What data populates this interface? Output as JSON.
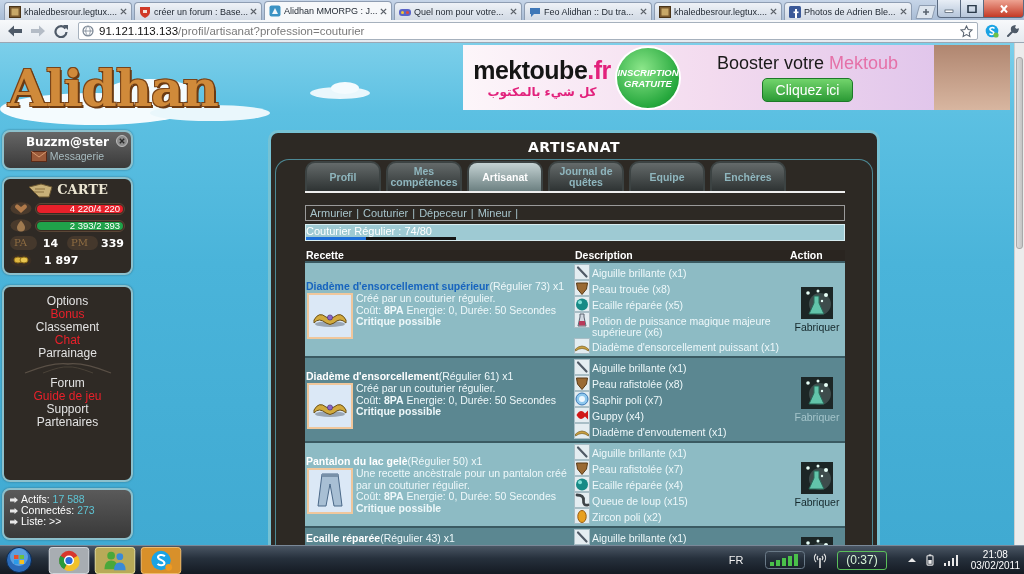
{
  "browser": {
    "tabs": [
      {
        "title": "khaledbesrour.legtux....",
        "kind": "photo",
        "selected": false
      },
      {
        "title": "créer un forum : Base...",
        "kind": "shield",
        "selected": false
      },
      {
        "title": "Alidhan MMORPG : J...",
        "kind": "game",
        "selected": true
      },
      {
        "title": "Quel nom pour votre...",
        "kind": "controller",
        "selected": false
      },
      {
        "title": "Feo Alidhan :: Du tra...",
        "kind": "forum",
        "selected": false
      },
      {
        "title": "khaledbesrour.legtux....",
        "kind": "photo",
        "selected": false
      },
      {
        "title": "Photos de Adrien Ble...",
        "kind": "social",
        "selected": false
      }
    ],
    "address": {
      "host": "91.121.113.133",
      "path": "/profil/artisanat?profession=couturier"
    }
  },
  "site": {
    "logo": "Alidhan",
    "banner": {
      "brand": "mektoube",
      "domain": ".fr",
      "tagline": "كل شيء بالمكتوب",
      "badge": "INSCRIPTION GRATUITE",
      "headline": "Booster votre",
      "headline_accent": "Mektoub",
      "button": "Cliquez ici"
    },
    "user": {
      "name": "Buzzm@ster",
      "messages": "Messagerie"
    },
    "card": {
      "title": "CARTE",
      "meters": [
        {
          "kind": "health",
          "reading": "4 220/4 220",
          "level": 1
        },
        {
          "kind": "mana",
          "reading": "2 393/2 393",
          "level": 1
        }
      ],
      "points": [
        {
          "label": "PA",
          "value": "14"
        },
        {
          "label": "PM",
          "value": "339"
        }
      ],
      "gold": "1 897"
    },
    "menu": [
      {
        "items": [
          {
            "label": "Options",
            "color": "#e2e2e2"
          },
          {
            "label": "Bonus",
            "color": "#e8202a"
          },
          {
            "label": "Classement",
            "color": "#e2e2e2"
          },
          {
            "label": "Chat",
            "color": "#e8202a"
          },
          {
            "label": "Parrainage",
            "color": "#e2e2e2"
          }
        ]
      },
      {
        "items": [
          {
            "label": "Forum",
            "color": "#e2e2e2"
          },
          {
            "label": "Guide de jeu",
            "color": "#e8202a"
          },
          {
            "label": "Support",
            "color": "#e2e2e2"
          },
          {
            "label": "Partenaires",
            "color": "#e2e2e2"
          }
        ]
      }
    ],
    "counters": [
      {
        "label": "Actifs:",
        "value": "17 588"
      },
      {
        "label": "Connectés:",
        "value": "273"
      },
      {
        "label": "Liste: >>"
      }
    ],
    "panel": {
      "title": "ARTISANAT",
      "tabs": [
        {
          "label": "Profil",
          "selected": false
        },
        {
          "label": "Mes compétences",
          "selected": false
        },
        {
          "label": "Artisanat",
          "selected": true
        },
        {
          "label": "Journal de quêtes",
          "selected": false
        },
        {
          "label": "Equipe",
          "selected": false
        },
        {
          "label": "Enchères",
          "selected": false
        }
      ],
      "professions": [
        "Armurier",
        "Couturier",
        "Dépeceur",
        "Mineur"
      ],
      "separator": "|",
      "progress": {
        "label": "Couturier Régulier : 74/80",
        "level": 0.4
      },
      "table": {
        "columns": [
          "Recette",
          "Description",
          "Action"
        ],
        "rows": [
          {
            "kind": "diadem",
            "name": "Diadème d'ensorcellement supérieur",
            "link": true,
            "grade": "(Régulier 73) x1",
            "description": "Créé par un couturier régulier.",
            "cost": "Coût: **8PA** Energie: 0, Durée: 50 Secondes",
            "note": "Critique possible",
            "ingredients": [
              {
                "kind": "needle",
                "text": "Aiguille brillante (x1)"
              },
              {
                "kind": "leather",
                "text": "Peau trouée (x8)"
              },
              {
                "kind": "orb",
                "text": "Ecaille réparée (x5)"
              },
              {
                "kind": "vial",
                "text": "Potion de puissance magique majeure supérieure (x6)"
              },
              {
                "kind": "diadem",
                "text": "Diadème d'ensorcellement puissant (x1)"
              }
            ],
            "action": {
              "label": "Fabriquer",
              "disabled": false
            }
          },
          {
            "kind": "diadem",
            "name": "Diadème d'ensorcellement",
            "link": false,
            "grade": "(Régulier 61) x1",
            "description": "Créé par un couturier régulier.",
            "cost": "Coût: **8PA** Energie: 0, Durée: 50 Secondes",
            "note": "Critique possible",
            "ingredients": [
              {
                "kind": "needle",
                "text": "Aiguille brillante (x1)"
              },
              {
                "kind": "leather",
                "text": "Peau rafistolée (x8)"
              },
              {
                "kind": "sapphire",
                "text": "Saphir poli (x7)"
              },
              {
                "kind": "fish",
                "text": "Guppy (x4)"
              },
              {
                "kind": "diadem",
                "text": "Diadème d'envoutement (x1)"
              }
            ],
            "action": {
              "label": "Fabriquer",
              "disabled": true
            }
          },
          {
            "kind": "pants",
            "name": "Pantalon du lac gelè",
            "link": false,
            "grade": "(Régulier 50) x1",
            "description": "Une recette ancèstrale pour un pantalon créé par un couturier régulier.",
            "cost": "Coût: **8PA** Energie: 0, Durée: 50 Secondes",
            "note": "Critique possible",
            "ingredients": [
              {
                "kind": "needle",
                "text": "Aiguille brillante (x1)"
              },
              {
                "kind": "leather",
                "text": "Peau rafistolée (x7)"
              },
              {
                "kind": "orb",
                "text": "Ecaille réparée (x4)"
              },
              {
                "kind": "tail",
                "text": "Queue de loup (x15)"
              },
              {
                "kind": "egg",
                "text": "Zircon poli (x2)"
              }
            ],
            "action": {
              "label": "Fabriquer",
              "disabled": false
            }
          },
          {
            "name": "Ecaille réparée",
            "link": false,
            "grade": "(Régulier 43) x1",
            "ingredients": [
              {
                "kind": "needle",
                "text": "Aiguille brillante (x1)"
              }
            ],
            "action": {
              "disabled": false
            }
          }
        ]
      }
    }
  },
  "taskbar": {
    "language": "FR",
    "battery": "(0:37)",
    "time": "21:08",
    "date": "03/02/2011"
  }
}
